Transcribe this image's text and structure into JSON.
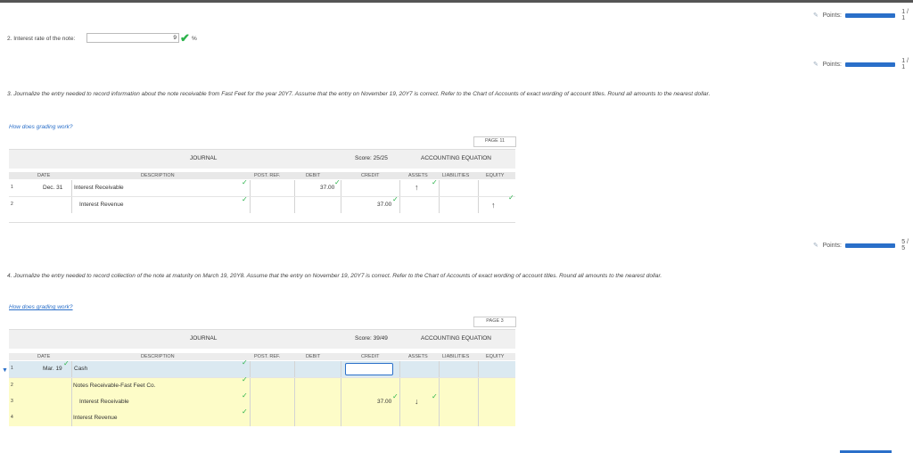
{
  "points": [
    {
      "label": "Points:",
      "score": "1 / 1"
    },
    {
      "label": "Points:",
      "score": "1 / 1"
    },
    {
      "label": "Points:",
      "score": "5 / 5"
    }
  ],
  "q2": {
    "label": "2. Interest rate of the note:",
    "value": "9",
    "unit": "%"
  },
  "q3": {
    "text": "3. Journalize the entry needed to record information about the note receivable from Fast Feet for the year 20Y7. Assume that the entry on November 19, 20Y7 is correct. Refer to the Chart of Accounts of exact wording of account titles. Round all amounts to the nearest dollar.",
    "link": "How does grading work?",
    "page": "PAGE 11",
    "journal_label": "JOURNAL",
    "score": "Score: 25/25",
    "equation_label": "ACCOUNTING EQUATION",
    "columns": {
      "date": "DATE",
      "description": "DESCRIPTION",
      "post_ref": "POST. REF.",
      "debit": "DEBIT",
      "credit": "CREDIT",
      "assets": "ASSETS",
      "liabilities": "LIABILITIES",
      "equity": "EQUITY"
    },
    "rows": [
      {
        "num": "1",
        "date": "Dec. 31",
        "description": "Interest Receivable",
        "debit": "37.00",
        "credit": "",
        "assets_arrow": "↑",
        "equity_arrow": ""
      },
      {
        "num": "2",
        "date": "",
        "description": "Interest Revenue",
        "debit": "",
        "credit": "37.00",
        "assets_arrow": "",
        "equity_arrow": "↑"
      }
    ]
  },
  "q4": {
    "text": "4. Journalize the entry needed to record collection of the note at maturity on March 19, 20Y8. Assume that the entry on November 19, 20Y7 is correct. Refer to the Chart of Accounts of exact wording of account titles. Round all amounts to the nearest dollar.",
    "link": "How does grading work?",
    "page": "PAGE 3",
    "journal_label": "JOURNAL",
    "score": "Score: 39/49",
    "equation_label": "ACCOUNTING EQUATION",
    "columns": {
      "date": "DATE",
      "description": "DESCRIPTION",
      "post_ref": "POST. REF.",
      "debit": "DEBIT",
      "credit": "CREDIT",
      "assets": "ASSETS",
      "liabilities": "LIABILITIES",
      "equity": "EQUITY"
    },
    "rows": [
      {
        "num": "1",
        "date": "Mar. 19",
        "description": "Cash",
        "credit": "",
        "assets_arrow": ""
      },
      {
        "num": "2",
        "date": "",
        "description": "Notes Receivable-Fast Feet Co.",
        "credit": "",
        "assets_arrow": ""
      },
      {
        "num": "3",
        "date": "",
        "description": "Interest Receivable",
        "credit": "37.00",
        "assets_arrow": "↓"
      },
      {
        "num": "4",
        "date": "",
        "description": "Interest Revenue",
        "credit": "",
        "assets_arrow": ""
      }
    ]
  },
  "colors": {
    "accent": "#2a6fc9",
    "check": "#2bb34b",
    "row_highlight": "#fdfcc8",
    "row_selected": "#dbe9f1"
  }
}
